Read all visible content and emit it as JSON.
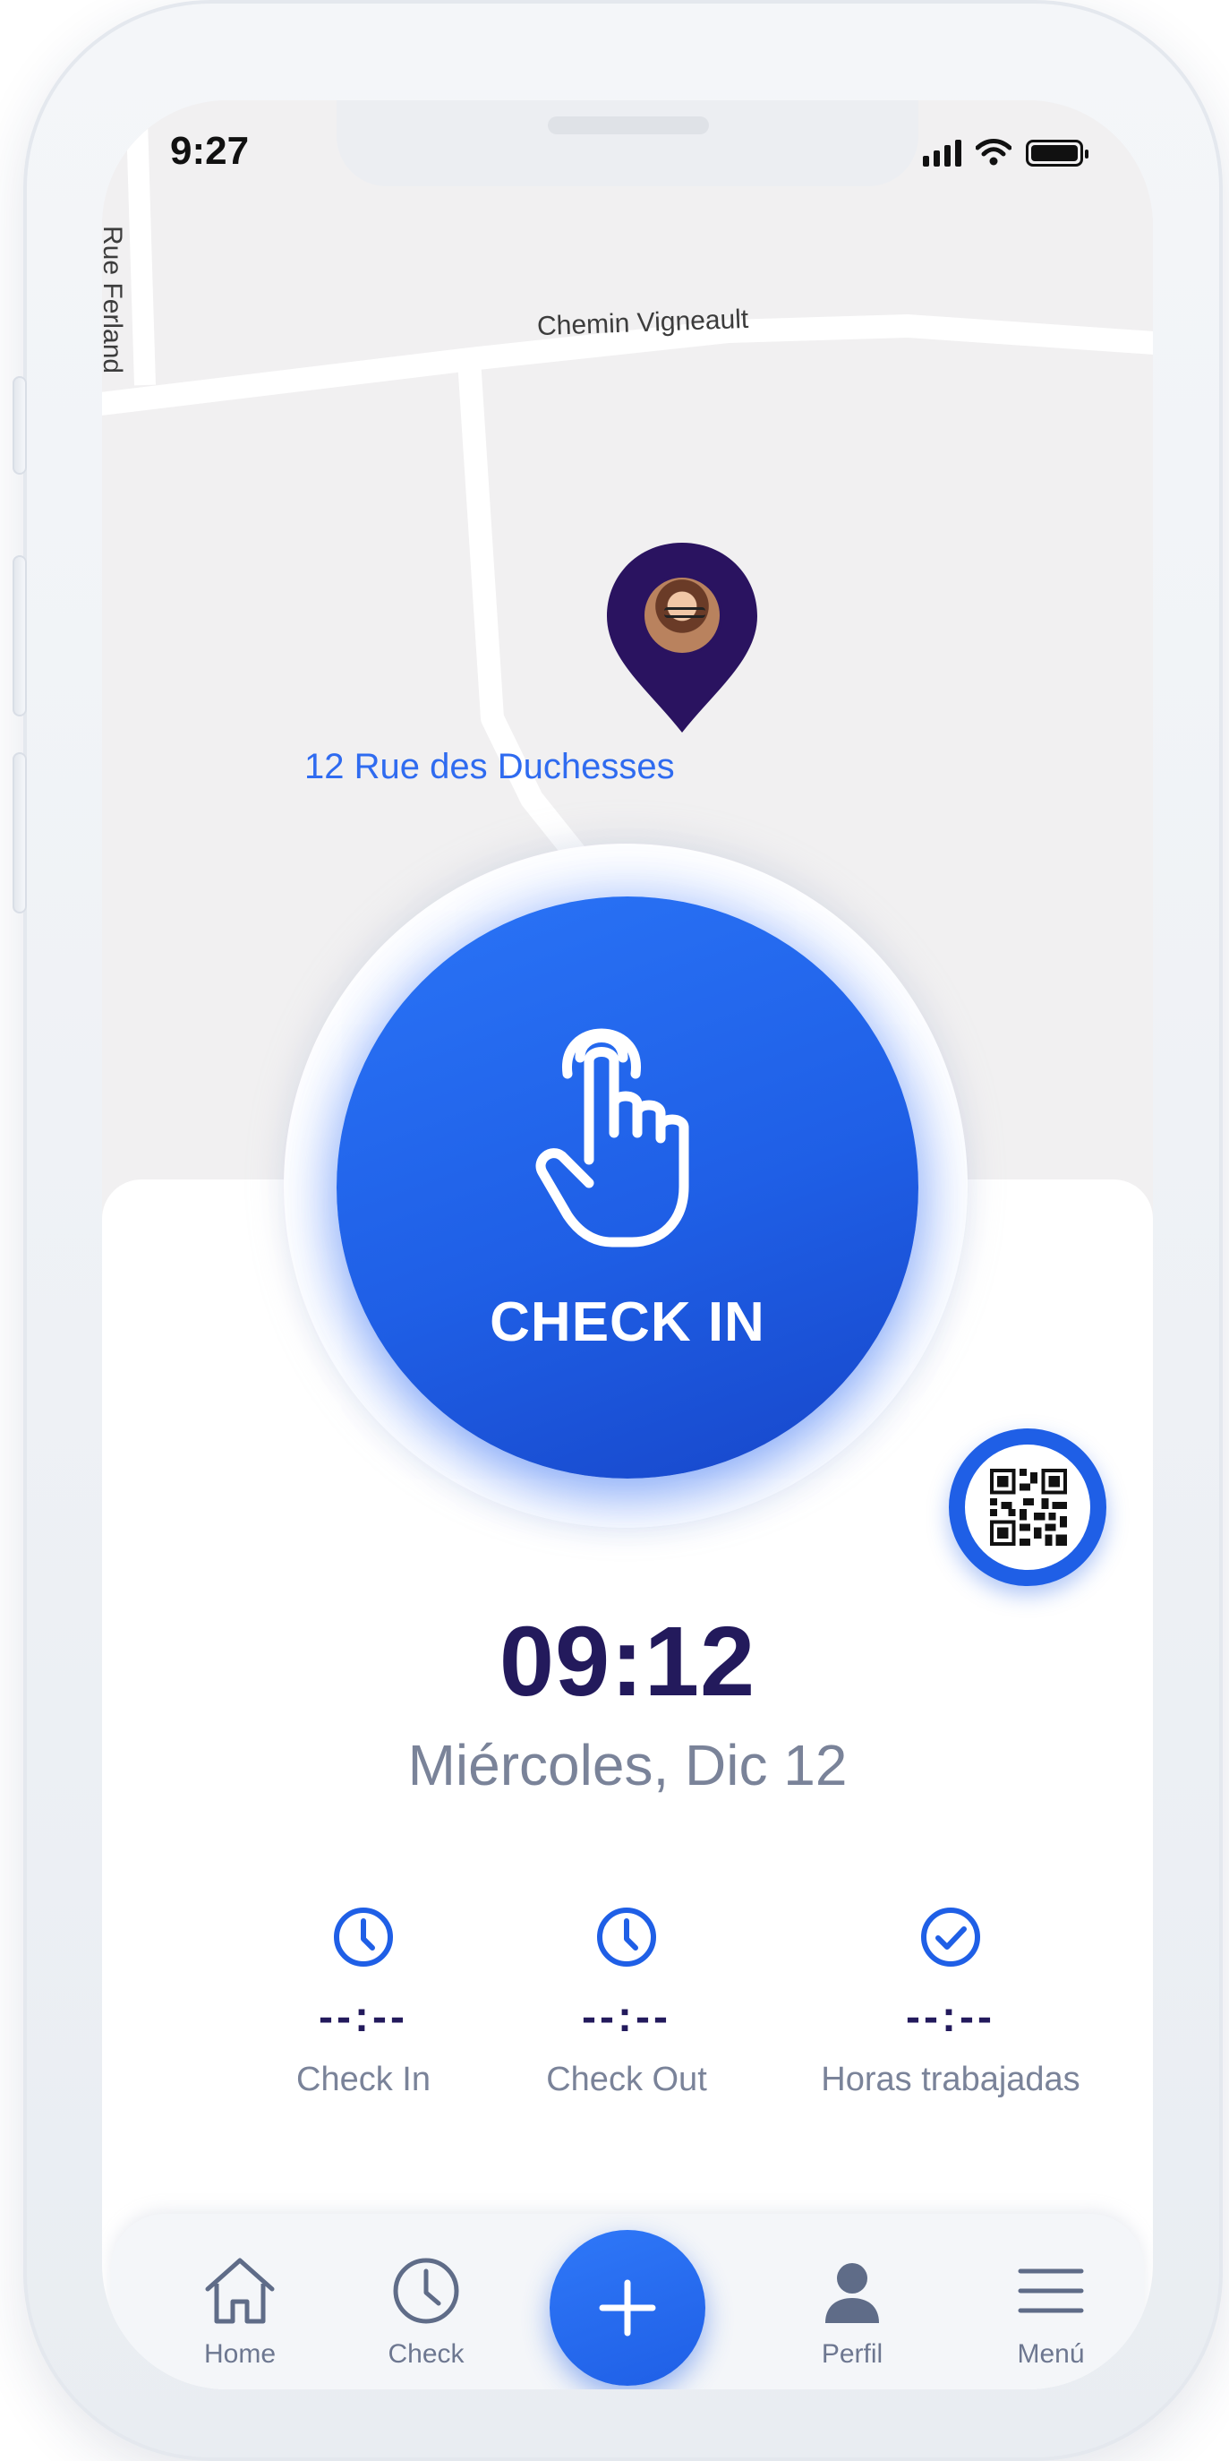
{
  "status_bar": {
    "time": "9:27"
  },
  "map": {
    "streets": [
      "Rue Ferland",
      "Chemin Vigneault"
    ],
    "place_label": "12 Rue des Duchesses"
  },
  "check_in": {
    "label": "CHECK IN",
    "icon": "tap-hand-icon"
  },
  "qr": {
    "icon": "qr-code-icon"
  },
  "clock": {
    "time": "09:12",
    "date": "Miércoles, Dic 12"
  },
  "stats": [
    {
      "icon": "clock-icon",
      "value": "--:--",
      "label": "Check In"
    },
    {
      "icon": "clock-icon",
      "value": "--:--",
      "label": "Check Out"
    },
    {
      "icon": "check-circle-icon",
      "value": "--:--",
      "label": "Horas trabajadas"
    }
  ],
  "tab_bar": {
    "items": [
      {
        "icon": "home-icon",
        "label": "Home"
      },
      {
        "icon": "clock-icon",
        "label": "Check"
      },
      {
        "icon": "user-icon",
        "label": "Perfil"
      },
      {
        "icon": "menu-icon",
        "label": "Menú"
      }
    ],
    "fab_icon": "plus-icon"
  },
  "colors": {
    "primary": "#1f5fe6",
    "dark_text": "#231a5c",
    "muted_text": "#7a8399",
    "link": "#2f6bf0"
  }
}
